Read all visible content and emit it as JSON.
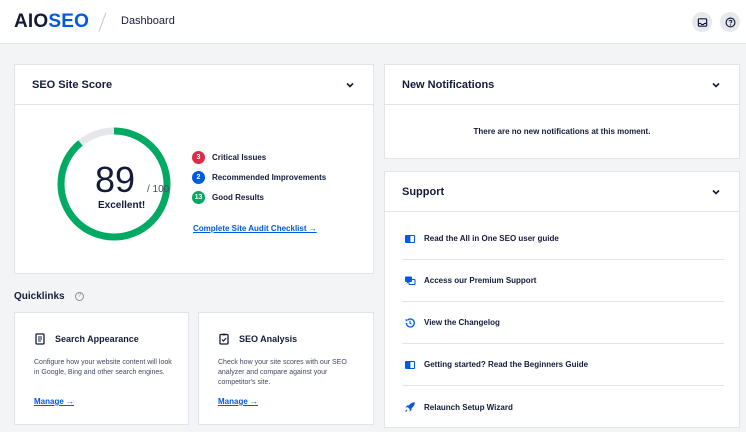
{
  "header": {
    "logo_aio": "AIO",
    "logo_seo_s": "S",
    "logo_seo_rest": "EO",
    "breadcrumb": "Dashboard"
  },
  "score_card": {
    "title": "SEO Site Score",
    "score": "89",
    "max": "/ 100",
    "score_fraction": 0.89,
    "rating": "Excellent!",
    "issues": [
      {
        "count": "3",
        "label": "Critical Issues",
        "color": "#df2a4a"
      },
      {
        "count": "2",
        "label": "Recommended Improvements",
        "color": "#005ae0"
      },
      {
        "count": "13",
        "label": "Good Results",
        "color": "#00aa63"
      }
    ],
    "audit_link": "Complete Site Audit Checklist →"
  },
  "quicklinks": {
    "title": "Quicklinks",
    "help": "?",
    "items": [
      {
        "title": "Search Appearance",
        "icon": "document-icon",
        "description": "Configure how your website content will look in Google, Bing and other search engines.",
        "link": "Manage →"
      },
      {
        "title": "SEO Analysis",
        "icon": "clipboard-check-icon",
        "description": "Check how your site scores with our SEO analyzer and compare against your competitor's site.",
        "link": "Manage →"
      }
    ]
  },
  "notifications": {
    "title": "New Notifications",
    "message": "There are no new notifications at this moment."
  },
  "support": {
    "title": "Support",
    "items": [
      {
        "label": "Read the All in One SEO user guide",
        "icon": "book-icon"
      },
      {
        "label": "Access our Premium Support",
        "icon": "chat-icon"
      },
      {
        "label": "View the Changelog",
        "icon": "history-icon"
      },
      {
        "label": "Getting started? Read the Beginners Guide",
        "icon": "book-icon"
      },
      {
        "label": "Relaunch Setup Wizard",
        "icon": "rocket-icon"
      }
    ]
  },
  "colors": {
    "accent": "#005ae0",
    "good": "#00aa63",
    "critical": "#df2a4a",
    "text": "#141b38"
  }
}
